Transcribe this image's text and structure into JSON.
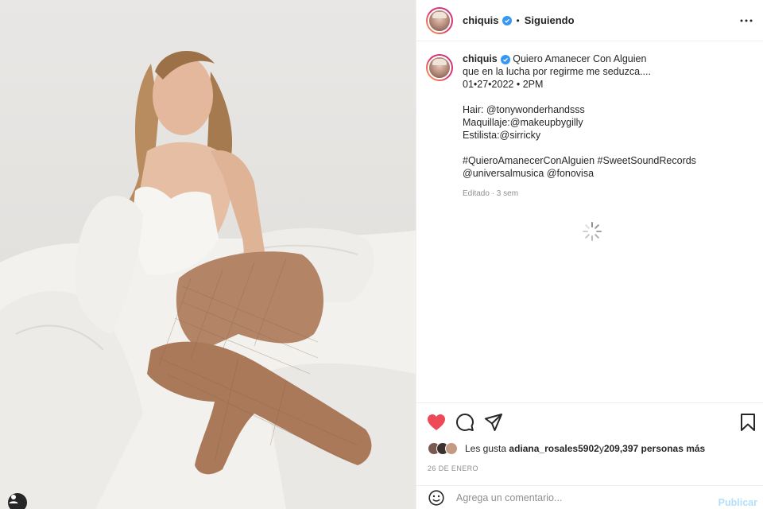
{
  "header": {
    "username": "chiquis",
    "separator": "•",
    "follow_status": "Siguiendo",
    "more_icon": "ellipsis-icon"
  },
  "caption": {
    "username": "chiquis",
    "lines": [
      "Quiero Amanecer Con Alguien",
      "que en la lucha por regirme me seduzca....",
      "01•27•2022 • 2PM"
    ],
    "credits": [
      "Hair: @tonywonderhandsss",
      "Maquillaje:@makeupbygilly",
      "Estilista:@sirricky"
    ],
    "tags": [
      "#QuieroAmanecerConAlguien #SweetSoundRecords",
      "@universalmusica @fonovisa"
    ],
    "edited": "Editado · 3 sem"
  },
  "likes": {
    "prefix": "Les gusta",
    "user": "adiana_rosales5902",
    "connector": "y",
    "count": "209,397 personas más"
  },
  "date": "26 DE ENERO",
  "comment": {
    "placeholder": "Agrega un comentario...",
    "publish": "Publicar"
  },
  "colors": {
    "like": "#ed4956",
    "verified": "#3897f0",
    "link": "#00376b",
    "publish_disabled": "#b2dffc"
  }
}
